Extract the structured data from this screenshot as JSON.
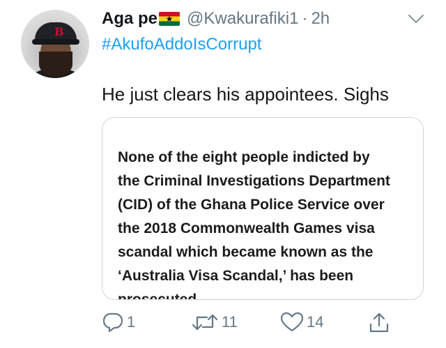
{
  "tweet": {
    "author": {
      "display_name": "Aga pe",
      "flag_icon": "ghana-flag-icon",
      "handle": "@Kwakurafiki1",
      "separator": "·",
      "time": "2h"
    },
    "hashtag": "#AkufoAddoIsCorrupt",
    "text": "He just clears his appointees. Sighs",
    "card": {
      "lines": [
        "None of the eight people indicted by",
        "the Criminal Investigations Department",
        "(CID) of the Ghana Police Service over",
        "the 2018 Commonwealth Games visa",
        "scandal which became known as the",
        "‘Australia Visa Scandal,’ has been",
        "prosecuted"
      ]
    },
    "actions": {
      "reply_count": "1",
      "retweet_count": "11",
      "like_count": "14"
    }
  },
  "colors": {
    "link": "#1da1f2",
    "muted": "#657786",
    "text": "#14171a",
    "border": "#ccd6dd"
  }
}
